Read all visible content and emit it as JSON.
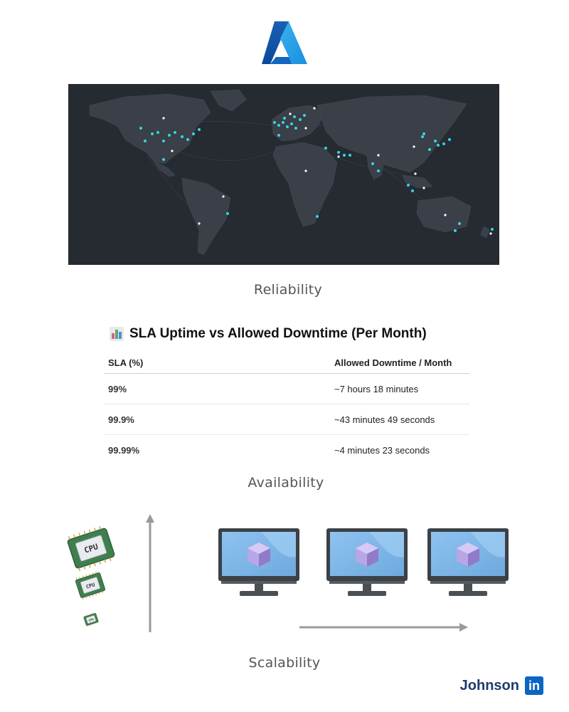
{
  "header": {
    "logo_icon": "azure-logo-icon"
  },
  "map": {
    "icon": "world-map-datacenters-icon",
    "region_color": "#33d6e6",
    "other_color": "#ffffff"
  },
  "captions": {
    "reliability": "Reliability",
    "availability": "Availability",
    "scalability": "Scalability"
  },
  "sla": {
    "title_icon": "bar-chart-icon",
    "title": "SLA Uptime vs Allowed Downtime (Per Month)",
    "headers": [
      "SLA (%)",
      "Allowed Downtime / Month"
    ],
    "rows": [
      [
        "99%",
        "~7 hours 18 minutes"
      ],
      [
        "99.9%",
        "~43 minutes 49 seconds"
      ],
      [
        "99.99%",
        "~4 minutes 23 seconds"
      ]
    ]
  },
  "scalability": {
    "vertical_icons": [
      "cpu-icon",
      "cpu-icon",
      "cpu-icon"
    ],
    "cpu_label": "CPU",
    "horizontal_icons": [
      "monitor-vm-icon",
      "monitor-vm-icon",
      "monitor-vm-icon"
    ]
  },
  "footer": {
    "author": "Johnson",
    "network_icon": "linkedin-icon",
    "network_label": "in"
  }
}
